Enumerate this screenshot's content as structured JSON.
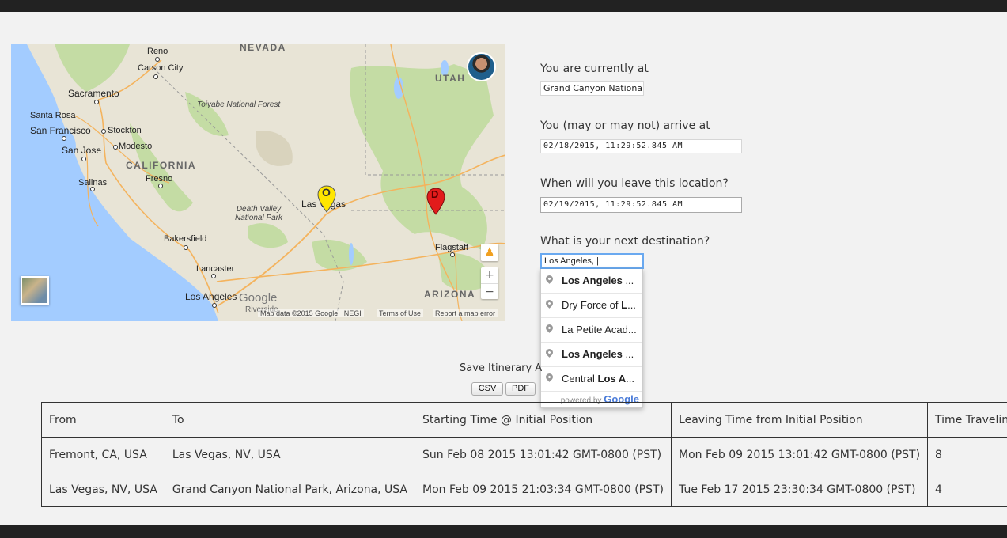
{
  "map": {
    "states": [
      "NEVADA",
      "UTAH",
      "CALIFORNIA",
      "ARIZONA"
    ],
    "cities": [
      "Reno",
      "Carson City",
      "Sacramento",
      "Santa Rosa",
      "San Francisco",
      "Stockton",
      "San Jose",
      "Modesto",
      "Salinas",
      "Fresno",
      "Las Vegas",
      "Bakersfield",
      "Lancaster",
      "Los Angeles",
      "Flagstaff",
      "Riverside"
    ],
    "parks": [
      "Toiyabe National Forest",
      "Death Valley National Park"
    ],
    "marker_origin": "O",
    "marker_destination": "D",
    "brand": "Google",
    "attribution": "Map data ©2015 Google, INEGI",
    "terms": "Terms of Use",
    "report": "Report a map error",
    "zoom_in": "+",
    "zoom_out": "−",
    "pegman_icon": "pegman-icon",
    "colors": {
      "water": "#a3ccff",
      "land": "#e8e4d6",
      "green": "#c4dca4",
      "road": "#f4b35d"
    }
  },
  "form": {
    "current_label": "You are currently at",
    "current_value": "Grand Canyon National",
    "arrive_label": "You (may or may not) arrive at",
    "arrive_value": "02/18/2015, 11:29:52.845 AM",
    "leave_label": "When will you leave this location?",
    "leave_value": "02/19/2015, 11:29:52.845 AM",
    "next_label": "What is your next destination?",
    "next_value": "Los Angeles, |"
  },
  "autocomplete": {
    "items": [
      {
        "bold": "Los Angeles",
        "rest": " ..."
      },
      {
        "pre": "Dry Force of ",
        "bold": "L",
        "rest": "..."
      },
      {
        "pre": "La Petite Acad",
        "rest": "..."
      },
      {
        "bold": "Los Angeles",
        "rest": " ..."
      },
      {
        "pre": "Central ",
        "bold": "Los A",
        "rest": "..."
      }
    ],
    "powered": "powered by",
    "brand": "Google"
  },
  "save": {
    "label": "Save Itinerary A",
    "csv": "CSV",
    "pdf": "PDF"
  },
  "table": {
    "headers": [
      "From",
      "To",
      "Starting Time @ Initial Position",
      "Leaving Time from Initial Position",
      "Time Traveling"
    ],
    "rows": [
      [
        "Fremont, CA, USA",
        "Las Vegas, NV, USA",
        "Sun Feb 08 2015 13:01:42 GMT-0800 (PST)",
        "Mon Feb 09 2015 13:01:42 GMT-0800 (PST)",
        "8"
      ],
      [
        "Las Vegas, NV, USA",
        "Grand Canyon National Park, Arizona, USA",
        "Mon Feb 09 2015 21:03:34 GMT-0800 (PST)",
        "Tue Feb 17 2015 23:30:34 GMT-0800 (PST)",
        "4"
      ]
    ]
  }
}
